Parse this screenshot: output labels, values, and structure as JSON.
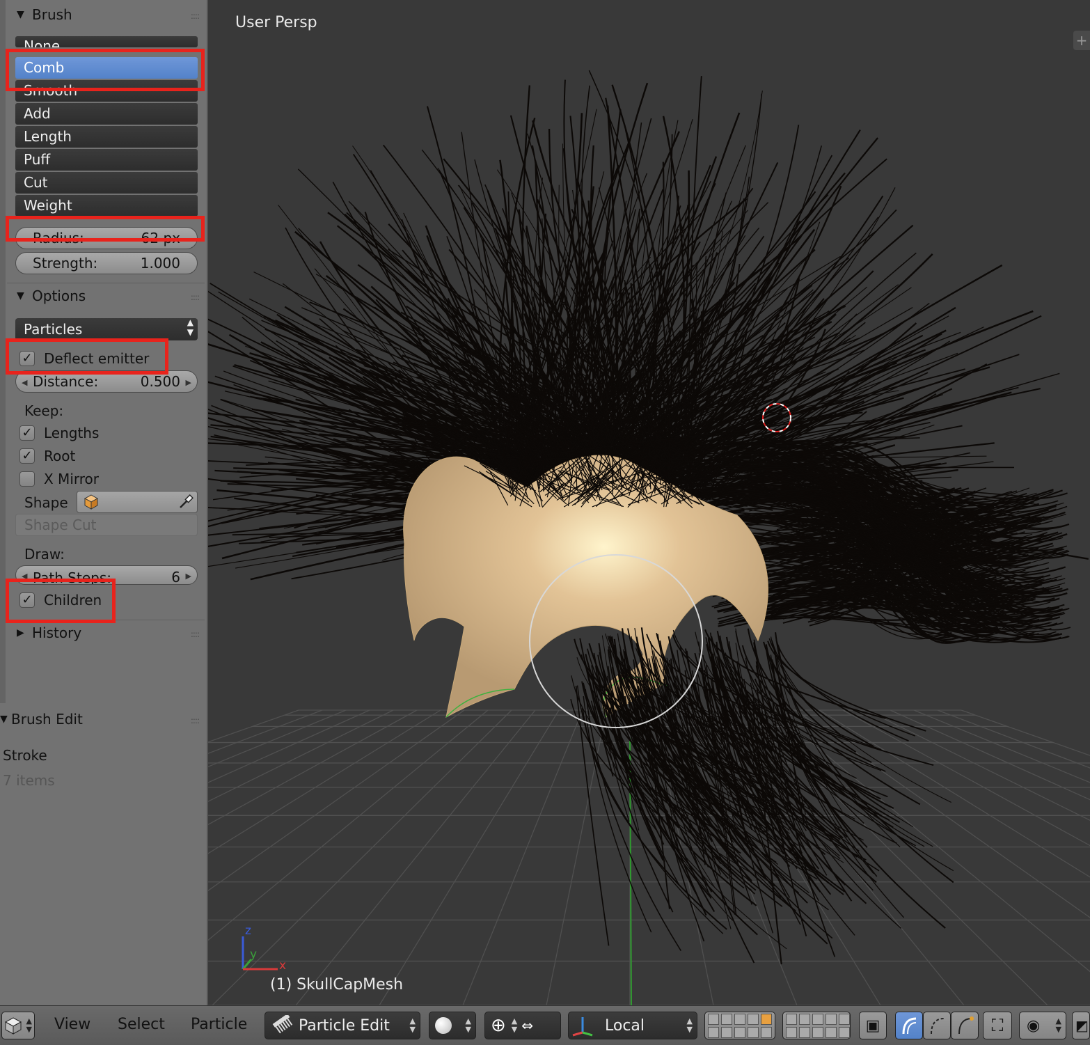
{
  "shelf": {
    "brush_panel": {
      "title": "Brush",
      "brushes": [
        "None",
        "Comb",
        "Smooth",
        "Add",
        "Length",
        "Puff",
        "Cut",
        "Weight"
      ],
      "selected": "Comb",
      "radius_label": "Radius:",
      "radius_value": "62 px",
      "strength_label": "Strength:",
      "strength_value": "1.000"
    },
    "options_panel": {
      "title": "Options",
      "mode_value": "Particles",
      "deflect_emitter": {
        "label": "Deflect emitter",
        "checked": true
      },
      "distance_label": "Distance:",
      "distance_value": "0.500",
      "keep_label": "Keep:",
      "keep_lengths": {
        "label": "Lengths",
        "checked": true
      },
      "keep_root": {
        "label": "Root",
        "checked": true
      },
      "x_mirror": {
        "label": "X Mirror",
        "checked": false
      },
      "shape_label": "Shape",
      "shape_cut_label": "Shape Cut",
      "draw_label": "Draw:",
      "path_steps_label": "Path Steps:",
      "path_steps_value": "6",
      "children": {
        "label": "Children",
        "checked": true
      }
    },
    "history_panel": {
      "title": "History"
    }
  },
  "operator_panel": {
    "title": "Brush Edit",
    "stroke_label": "Stroke",
    "stroke_value": "7 items"
  },
  "viewport": {
    "view_name": "User Persp",
    "object_name": "(1) SkullCapMesh",
    "axis_labels": {
      "x": "x",
      "y": "y",
      "z": "z"
    }
  },
  "header": {
    "menus": [
      "View",
      "Select",
      "Particle"
    ],
    "mode": "Particle Edit",
    "transform_orientation": "Local"
  },
  "colors": {
    "highlight_red": "#e8231c",
    "selected_blue": "#5b8ad0",
    "viewport_bg": "#393939",
    "shelf_bg": "#727272",
    "hair": "#0c0907",
    "scalp": "#e2c396"
  }
}
